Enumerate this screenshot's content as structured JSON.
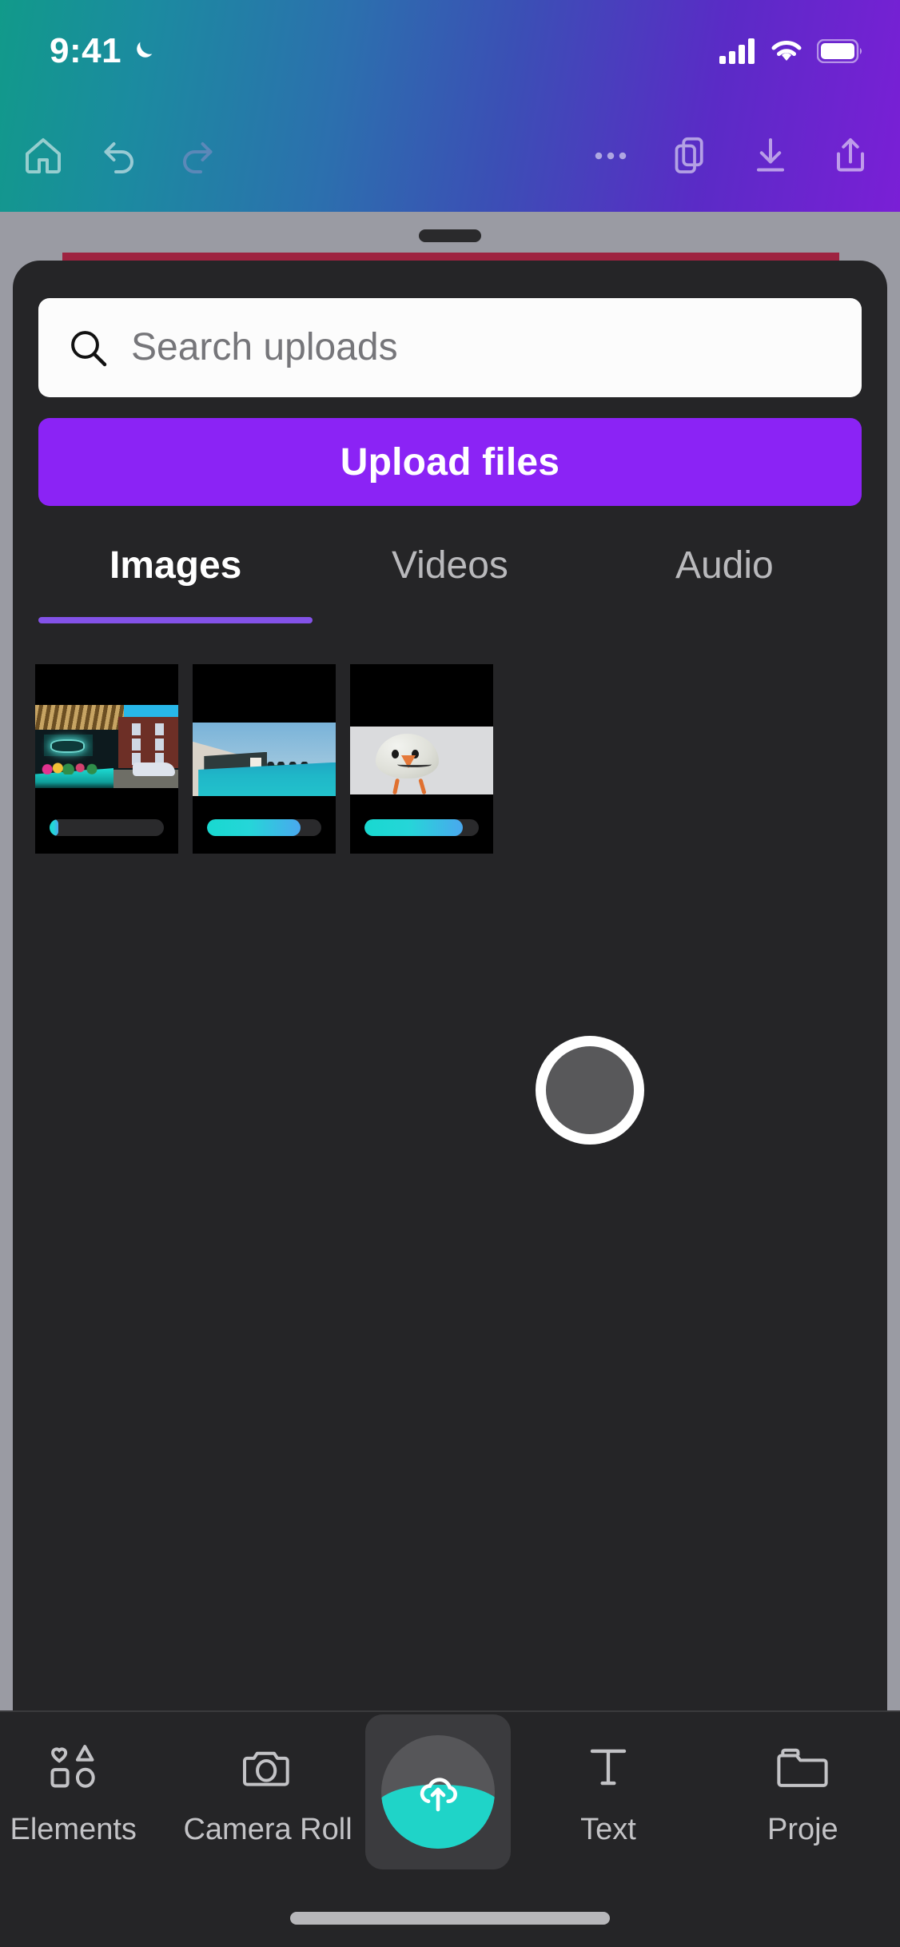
{
  "status_bar": {
    "time": "9:41",
    "moon_icon": "crescent-moon-icon",
    "cellular_icon": "cellular-signal-icon",
    "wifi_icon": "wifi-icon",
    "battery_icon": "battery-full-icon"
  },
  "toolbar": {
    "home_icon": "home-icon",
    "undo_icon": "undo-arrow-icon",
    "redo_icon": "redo-arrow-icon",
    "more_icon": "more-horizontal-icon",
    "layers_icon": "duplicate-pages-icon",
    "download_icon": "download-icon",
    "share_icon": "share-upload-icon"
  },
  "sheet": {
    "drag_handle": "drag-handle",
    "search": {
      "placeholder": "Search uploads",
      "value": "",
      "icon": "search-icon"
    },
    "upload_button": {
      "label": "Upload files",
      "color": "#8b23f5"
    },
    "tabs": [
      {
        "label": "Images",
        "active": true
      },
      {
        "label": "Videos",
        "active": false
      },
      {
        "label": "Audio",
        "active": false
      }
    ],
    "tab_underline_color": "#8352e8",
    "uploads": [
      {
        "name": "neon-street-thumbnail",
        "progress": 8
      },
      {
        "name": "infinity-pool-thumbnail",
        "progress": 82
      },
      {
        "name": "egg-character-thumbnail",
        "progress": 86
      }
    ],
    "progress_gradient": [
      "#18d8d0",
      "#4aa8ee"
    ],
    "loader": "upload-spinner"
  },
  "bottom_nav": [
    {
      "label": "Elements",
      "icon": "shapes-icon",
      "active": false
    },
    {
      "label": "Camera Roll",
      "icon": "camera-icon",
      "active": false
    },
    {
      "label": "",
      "icon": "cloud-upload-icon",
      "active": true
    },
    {
      "label": "Text",
      "icon": "text-t-icon",
      "active": false
    },
    {
      "label": "Proje",
      "icon": "folder-icon",
      "active": false
    }
  ],
  "home_indicator": "home-indicator"
}
